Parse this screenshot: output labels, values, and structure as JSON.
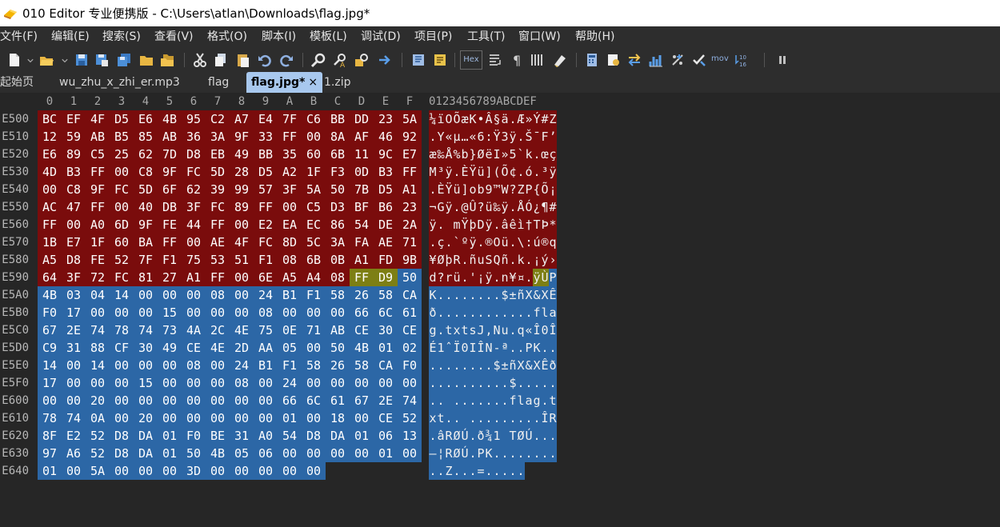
{
  "window": {
    "title": "010 Editor 专业便携版 - C:\\Users\\atlan\\Downloads\\flag.jpg*"
  },
  "menu": [
    "文件(F)",
    "编辑(E)",
    "搜索(S)",
    "查看(V)",
    "格式(O)",
    "脚本(I)",
    "模板(L)",
    "调试(D)",
    "项目(P)",
    "工具(T)",
    "窗口(W)",
    "帮助(H)"
  ],
  "toolbar": {
    "hex_label": "Hex",
    "mov_label": "mov",
    "icons": [
      "new-file-icon",
      "open-folder-icon",
      "save-icon",
      "save-as-icon",
      "save-all-icon",
      "folder-icon",
      "open-folders-icon",
      "cut-icon",
      "copy-icon",
      "paste-icon",
      "undo-icon",
      "redo-icon",
      "find-icon",
      "replace-icon",
      "find-in-files-icon",
      "goto-icon",
      "bookmark-icon",
      "template-icon",
      "hex-mode-icon",
      "line-break-icon",
      "pilcrow-icon",
      "columns-icon",
      "highlight-icon",
      "calculator-icon",
      "inspector-icon",
      "swap-icon",
      "histogram-icon",
      "percent-icon",
      "check-icon",
      "mov-icon",
      "base-convert-icon",
      "pause-icon"
    ]
  },
  "tabs": [
    {
      "label": "起始页",
      "active": false
    },
    {
      "label": "wu_zhu_x_zhi_er.mp3",
      "active": false
    },
    {
      "label": "flag",
      "active": false
    },
    {
      "label": "flag.jpg*",
      "active": true,
      "close": "×"
    },
    {
      "label": "1.zip",
      "active": false
    }
  ],
  "hex": {
    "columns": [
      "0",
      "1",
      "2",
      "3",
      "4",
      "5",
      "6",
      "7",
      "8",
      "9",
      "A",
      "B",
      "C",
      "D",
      "E",
      "F"
    ],
    "ascii_header": "0123456789ABCDEF",
    "rows": [
      {
        "offset": "E500",
        "bytes": [
          "BC",
          "EF",
          "4F",
          "D5",
          "E6",
          "4B",
          "95",
          "C2",
          "A7",
          "E4",
          "7F",
          "C6",
          "BB",
          "DD",
          "23",
          "5A"
        ],
        "ascii": "¼ïOÕæK•Â§ä.Æ»Ý#Z"
      },
      {
        "offset": "E510",
        "bytes": [
          "12",
          "59",
          "AB",
          "B5",
          "85",
          "AB",
          "36",
          "3A",
          "9F",
          "33",
          "FF",
          "00",
          "8A",
          "AF",
          "46",
          "92"
        ],
        "ascii": ".Y«µ…«6:Ÿ3ÿ.Š¯F’"
      },
      {
        "offset": "E520",
        "bytes": [
          "E6",
          "89",
          "C5",
          "25",
          "62",
          "7D",
          "D8",
          "EB",
          "49",
          "BB",
          "35",
          "60",
          "6B",
          "11",
          "9C",
          "E7"
        ],
        "ascii": "æ‰Å%b}ØëI»5`k.œç"
      },
      {
        "offset": "E530",
        "bytes": [
          "4D",
          "B3",
          "FF",
          "00",
          "C8",
          "9F",
          "FC",
          "5D",
          "28",
          "D5",
          "A2",
          "1F",
          "F3",
          "0D",
          "B3",
          "FF"
        ],
        "ascii": "M³ÿ.ÈŸü](Õ¢.ó.³ÿ"
      },
      {
        "offset": "E540",
        "bytes": [
          "00",
          "C8",
          "9F",
          "FC",
          "5D",
          "6F",
          "62",
          "39",
          "99",
          "57",
          "3F",
          "5A",
          "50",
          "7B",
          "D5",
          "A1"
        ],
        "ascii": ".ÈŸü]ob9™W?ZP{Õ¡"
      },
      {
        "offset": "E550",
        "bytes": [
          "AC",
          "47",
          "FF",
          "00",
          "40",
          "DB",
          "3F",
          "FC",
          "89",
          "FF",
          "00",
          "C5",
          "D3",
          "BF",
          "B6",
          "23"
        ],
        "ascii": "¬Gÿ.@Û?ü‰ÿ.ÅÓ¿¶#"
      },
      {
        "offset": "E560",
        "bytes": [
          "FF",
          "00",
          "A0",
          "6D",
          "9F",
          "FE",
          "44",
          "FF",
          "00",
          "E2",
          "EA",
          "EC",
          "86",
          "54",
          "DE",
          "2A"
        ],
        "ascii": "ÿ. mŸþDÿ.âêì†TÞ*"
      },
      {
        "offset": "E570",
        "bytes": [
          "1B",
          "E7",
          "1F",
          "60",
          "BA",
          "FF",
          "00",
          "AE",
          "4F",
          "FC",
          "8D",
          "5C",
          "3A",
          "FA",
          "AE",
          "71"
        ],
        "ascii": ".ç.`ºÿ.®Oü.\\:ú®q"
      },
      {
        "offset": "E580",
        "bytes": [
          "A5",
          "D8",
          "FE",
          "52",
          "7F",
          "F1",
          "75",
          "53",
          "51",
          "F1",
          "08",
          "6B",
          "0B",
          "A1",
          "FD",
          "9B"
        ],
        "ascii": "¥ØþR.ñuSQñ.k.¡ý›"
      },
      {
        "offset": "E590",
        "bytes": [
          "64",
          "3F",
          "72",
          "FC",
          "81",
          "27",
          "A1",
          "FF",
          "00",
          "6E",
          "A5",
          "A4",
          "08",
          "FF",
          "D9",
          "50"
        ],
        "ascii": "d?rü.'¡ÿ.n¥¤.ÿÙP"
      },
      {
        "offset": "E5A0",
        "bytes": [
          "4B",
          "03",
          "04",
          "14",
          "00",
          "00",
          "00",
          "08",
          "00",
          "24",
          "B1",
          "F1",
          "58",
          "26",
          "58",
          "CA"
        ],
        "ascii": "K........$±ñX&XÊ"
      },
      {
        "offset": "E5B0",
        "bytes": [
          "F0",
          "17",
          "00",
          "00",
          "00",
          "15",
          "00",
          "00",
          "00",
          "08",
          "00",
          "00",
          "00",
          "66",
          "6C",
          "61"
        ],
        "ascii": "ð............fla"
      },
      {
        "offset": "E5C0",
        "bytes": [
          "67",
          "2E",
          "74",
          "78",
          "74",
          "73",
          "4A",
          "2C",
          "4E",
          "75",
          "0E",
          "71",
          "AB",
          "CE",
          "30",
          "CE"
        ],
        "ascii": "g.txtsJ,Nu.q«Î0Î"
      },
      {
        "offset": "E5D0",
        "bytes": [
          "C9",
          "31",
          "88",
          "CF",
          "30",
          "49",
          "CE",
          "4E",
          "2D",
          "AA",
          "05",
          "00",
          "50",
          "4B",
          "01",
          "02"
        ],
        "ascii": "É1ˆÏ0IÎN-ª..PK.."
      },
      {
        "offset": "E5E0",
        "bytes": [
          "14",
          "00",
          "14",
          "00",
          "00",
          "00",
          "08",
          "00",
          "24",
          "B1",
          "F1",
          "58",
          "26",
          "58",
          "CA",
          "F0"
        ],
        "ascii": "........$±ñX&XÊð"
      },
      {
        "offset": "E5F0",
        "bytes": [
          "17",
          "00",
          "00",
          "00",
          "15",
          "00",
          "00",
          "00",
          "08",
          "00",
          "24",
          "00",
          "00",
          "00",
          "00",
          "00"
        ],
        "ascii": "..........$....."
      },
      {
        "offset": "E600",
        "bytes": [
          "00",
          "00",
          "20",
          "00",
          "00",
          "00",
          "00",
          "00",
          "00",
          "00",
          "66",
          "6C",
          "61",
          "67",
          "2E",
          "74"
        ],
        "ascii": ".. .......flag.t"
      },
      {
        "offset": "E610",
        "bytes": [
          "78",
          "74",
          "0A",
          "00",
          "20",
          "00",
          "00",
          "00",
          "00",
          "00",
          "01",
          "00",
          "18",
          "00",
          "CE",
          "52"
        ],
        "ascii": "xt.. .........ÎR"
      },
      {
        "offset": "E620",
        "bytes": [
          "8F",
          "E2",
          "52",
          "D8",
          "DA",
          "01",
          "F0",
          "BE",
          "31",
          "A0",
          "54",
          "D8",
          "DA",
          "01",
          "06",
          "13"
        ],
        "ascii": ".âRØÚ.ð¾1 TØÚ..."
      },
      {
        "offset": "E630",
        "bytes": [
          "97",
          "A6",
          "52",
          "D8",
          "DA",
          "01",
          "50",
          "4B",
          "05",
          "06",
          "00",
          "00",
          "00",
          "00",
          "01",
          "00"
        ],
        "ascii": "—¦RØÚ.PK........"
      },
      {
        "offset": "E640",
        "bytes": [
          "01",
          "00",
          "5A",
          "00",
          "00",
          "00",
          "3D",
          "00",
          "00",
          "00",
          "00",
          "00"
        ],
        "ascii": "..Z...=....."
      }
    ]
  },
  "colors": {
    "red_selection": "#7a0c0c",
    "blue_selection": "#2c67a6",
    "highlight": "#7d7f14",
    "background": "#262626"
  }
}
